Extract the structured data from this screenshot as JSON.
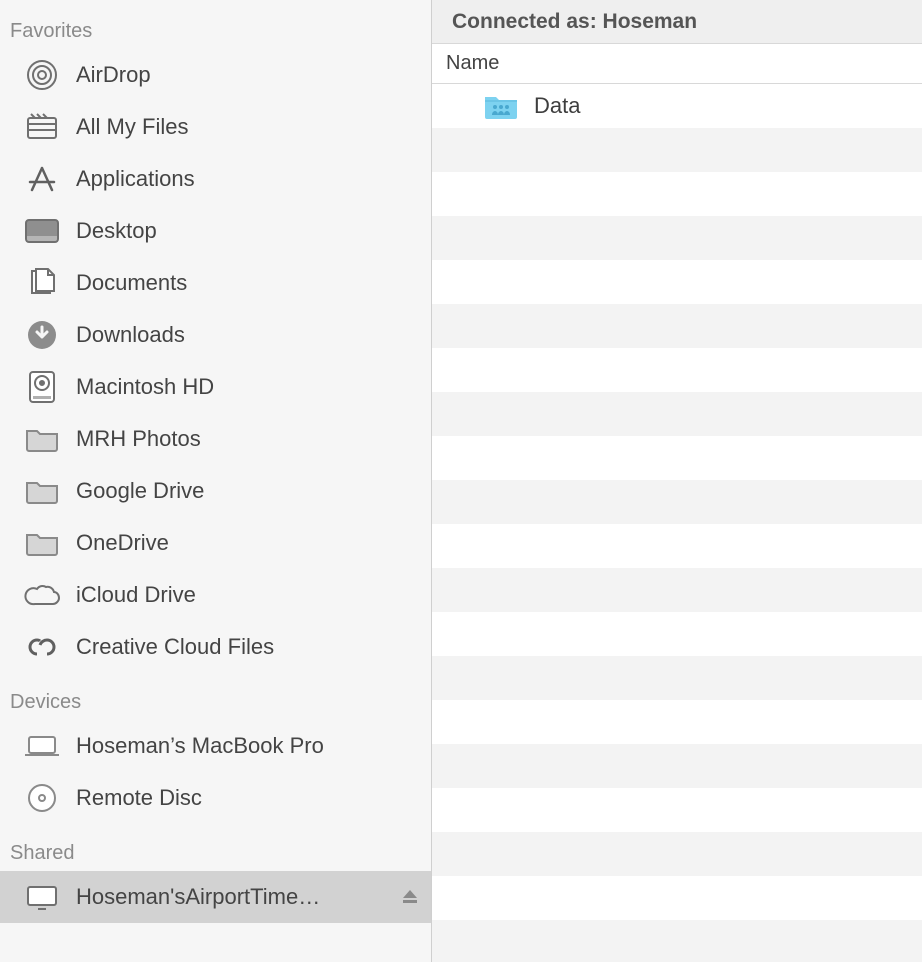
{
  "sidebar": {
    "sections": {
      "favorites": {
        "header": "Favorites"
      },
      "devices": {
        "header": "Devices"
      },
      "shared": {
        "header": "Shared"
      }
    },
    "favorites_items": [
      {
        "label": "AirDrop",
        "icon": "airdrop-icon"
      },
      {
        "label": "All My Files",
        "icon": "allfiles-icon"
      },
      {
        "label": "Applications",
        "icon": "applications-icon"
      },
      {
        "label": "Desktop",
        "icon": "desktop-icon"
      },
      {
        "label": "Documents",
        "icon": "documents-icon"
      },
      {
        "label": "Downloads",
        "icon": "downloads-icon"
      },
      {
        "label": "Macintosh HD",
        "icon": "hdd-icon"
      },
      {
        "label": "MRH Photos",
        "icon": "folder-icon"
      },
      {
        "label": "Google Drive",
        "icon": "folder-icon"
      },
      {
        "label": "OneDrive",
        "icon": "folder-icon"
      },
      {
        "label": "iCloud Drive",
        "icon": "cloud-icon"
      },
      {
        "label": "Creative Cloud Files",
        "icon": "cc-icon"
      }
    ],
    "devices_items": [
      {
        "label": "Hoseman’s MacBook Pro",
        "icon": "laptop-icon"
      },
      {
        "label": "Remote Disc",
        "icon": "disc-icon"
      }
    ],
    "shared_items": [
      {
        "label": "Hoseman'sAirportTime…",
        "icon": "monitor-icon",
        "selected": true
      }
    ]
  },
  "main": {
    "connected_as_label": "Connected as: Hoseman",
    "column_header": "Name",
    "rows": [
      {
        "name": "Data",
        "icon": "shared-folder-icon"
      }
    ]
  }
}
